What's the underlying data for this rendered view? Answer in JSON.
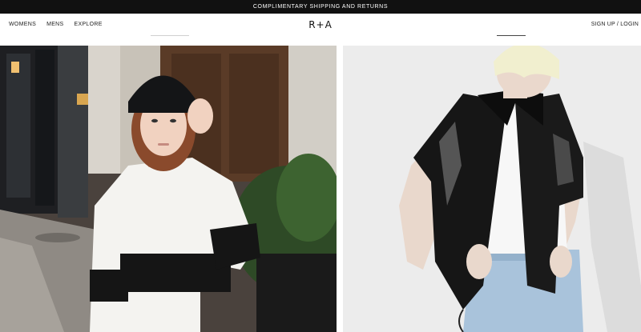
{
  "promo": {
    "text": "COMPLIMENTARY SHIPPING AND RETURNS"
  },
  "nav": {
    "items": [
      {
        "label": "WOMENS"
      },
      {
        "label": "MENS"
      },
      {
        "label": "EXPLORE"
      }
    ],
    "logo": "R+A",
    "account": "SIGN UP / LOGIN"
  },
  "hero": {
    "left_image": "womens-campaign-photo",
    "right_image": "mens-campaign-photo"
  },
  "colors": {
    "promo_bg": "#111111",
    "page_bg": "#ffffff",
    "text": "#111111"
  }
}
